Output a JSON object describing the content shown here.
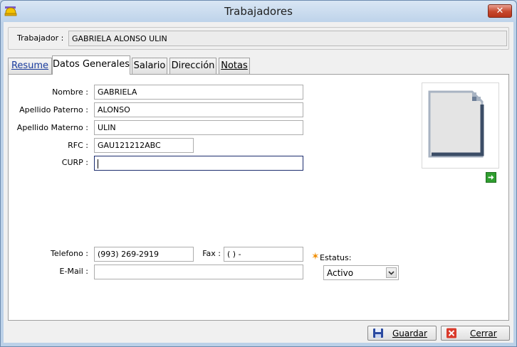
{
  "window": {
    "title": "Trabajadores",
    "close_glyph": "✕"
  },
  "header": {
    "label": "Trabajador :",
    "value": "GABRIELA ALONSO ULIN"
  },
  "tabs": [
    {
      "label": "Resume"
    },
    {
      "label": "Datos Generales"
    },
    {
      "label": "Salario"
    },
    {
      "label": "Dirección"
    },
    {
      "label": "Notas"
    }
  ],
  "form": {
    "nombre": {
      "label": "Nombre :",
      "value": "GABRIELA"
    },
    "apellido_paterno": {
      "label": "Apellido Paterno :",
      "value": "ALONSO"
    },
    "apellido_materno": {
      "label": "Apellido Materno :",
      "value": "ULIN"
    },
    "rfc": {
      "label": "RFC :",
      "value": "GAU121212ABC"
    },
    "curp": {
      "label": "CURP :",
      "value": ""
    },
    "telefono": {
      "label": "Telefono :",
      "value": "(993) 269-2919"
    },
    "fax": {
      "label": "Fax :",
      "value": "(  )    -"
    },
    "email": {
      "label": "E-Mail :",
      "value": ""
    },
    "estatus": {
      "label": "Estatus:",
      "value": "Activo",
      "required_mark": "✶"
    }
  },
  "buttons": {
    "save": "Guardar",
    "close": "Cerrar"
  },
  "icons": {
    "app": "hard-hat-icon",
    "photo": "blank-document-icon",
    "next": "arrow-right-icon",
    "save": "floppy-disk-icon",
    "cancel": "red-x-icon"
  },
  "colors": {
    "accent": "#f08c00",
    "tab_link": "#1a3c9e",
    "close": "#c6462c"
  }
}
